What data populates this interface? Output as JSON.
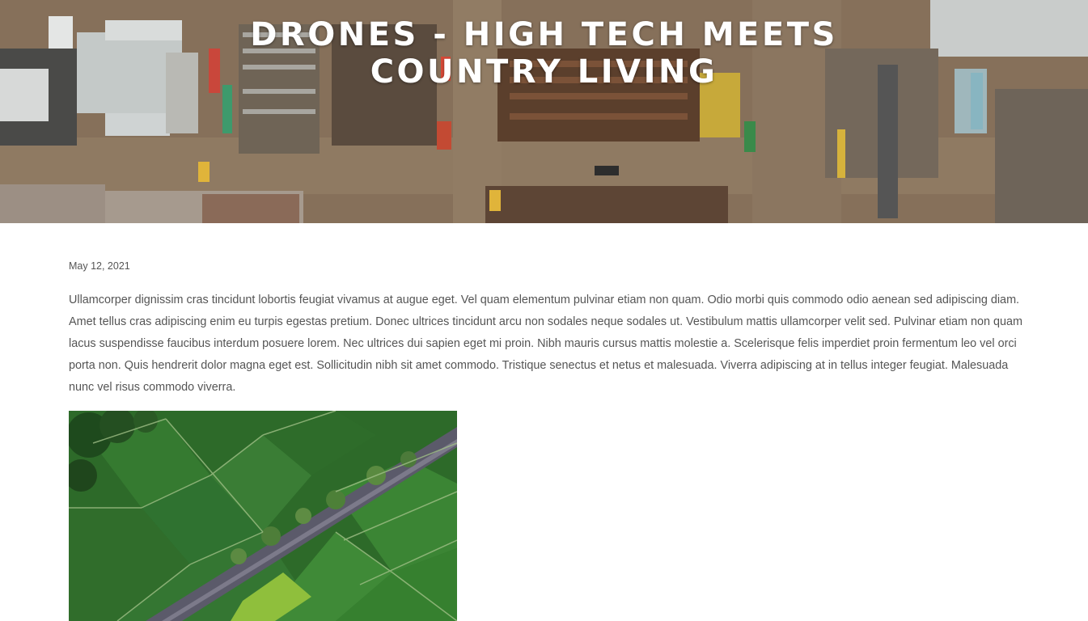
{
  "hero": {
    "title": "DRONES - HIGH TECH MEETS COUNTRY LIVING",
    "background_image": "aerial-industrial-yard-photo"
  },
  "article": {
    "date": "May 12, 2021",
    "body": "Ullamcorper dignissim cras tincidunt lobortis feugiat vivamus at augue eget. Vel quam elementum pulvinar etiam non quam. Odio morbi quis commodo odio aenean sed adipiscing diam. Amet tellus cras adipiscing enim eu turpis egestas pretium. Donec ultrices tincidunt arcu non sodales neque sodales ut. Vestibulum mattis ullamcorper velit sed. Pulvinar etiam non quam lacus suspendisse faucibus interdum posuere lorem. Nec ultrices dui sapien eget mi proin. Nibh mauris cursus mattis molestie a. Scelerisque felis imperdiet proin fermentum leo vel orci porta non. Quis hendrerit dolor magna eget est. Sollicitudin nibh sit amet commodo. Tristique senectus et netus et malesuada. Viverra adipiscing at in tellus integer feugiat. Malesuada nunc vel risus commodo viverra.",
    "image": "aerial-rice-fields-photo"
  },
  "colors": {
    "text": "#555555",
    "title": "#ffffff",
    "background": "#ffffff",
    "field_green": "#2f6b2a"
  }
}
